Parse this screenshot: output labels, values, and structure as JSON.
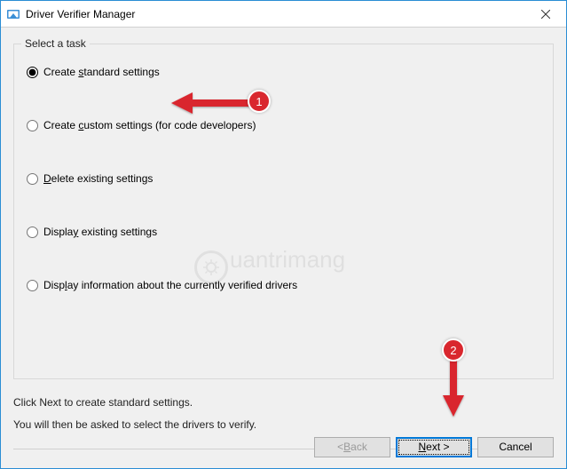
{
  "window": {
    "title": "Driver Verifier Manager"
  },
  "group": {
    "legend": "Select a task"
  },
  "options": {
    "o1": "Create standard settings",
    "o2": "Create custom settings (for code developers)",
    "o3": "Delete existing settings",
    "o4": "Display existing settings",
    "o5": "Display information about the currently verified drivers"
  },
  "hint": {
    "line1": "Click Next to create standard settings.",
    "line2": "You will then be asked to select the drivers to verify."
  },
  "buttons": {
    "back": "< Back",
    "next": "Next >",
    "cancel": "Cancel"
  },
  "annotations": {
    "badge1": "1",
    "badge2": "2"
  },
  "watermark": {
    "text": "uantrimang"
  }
}
